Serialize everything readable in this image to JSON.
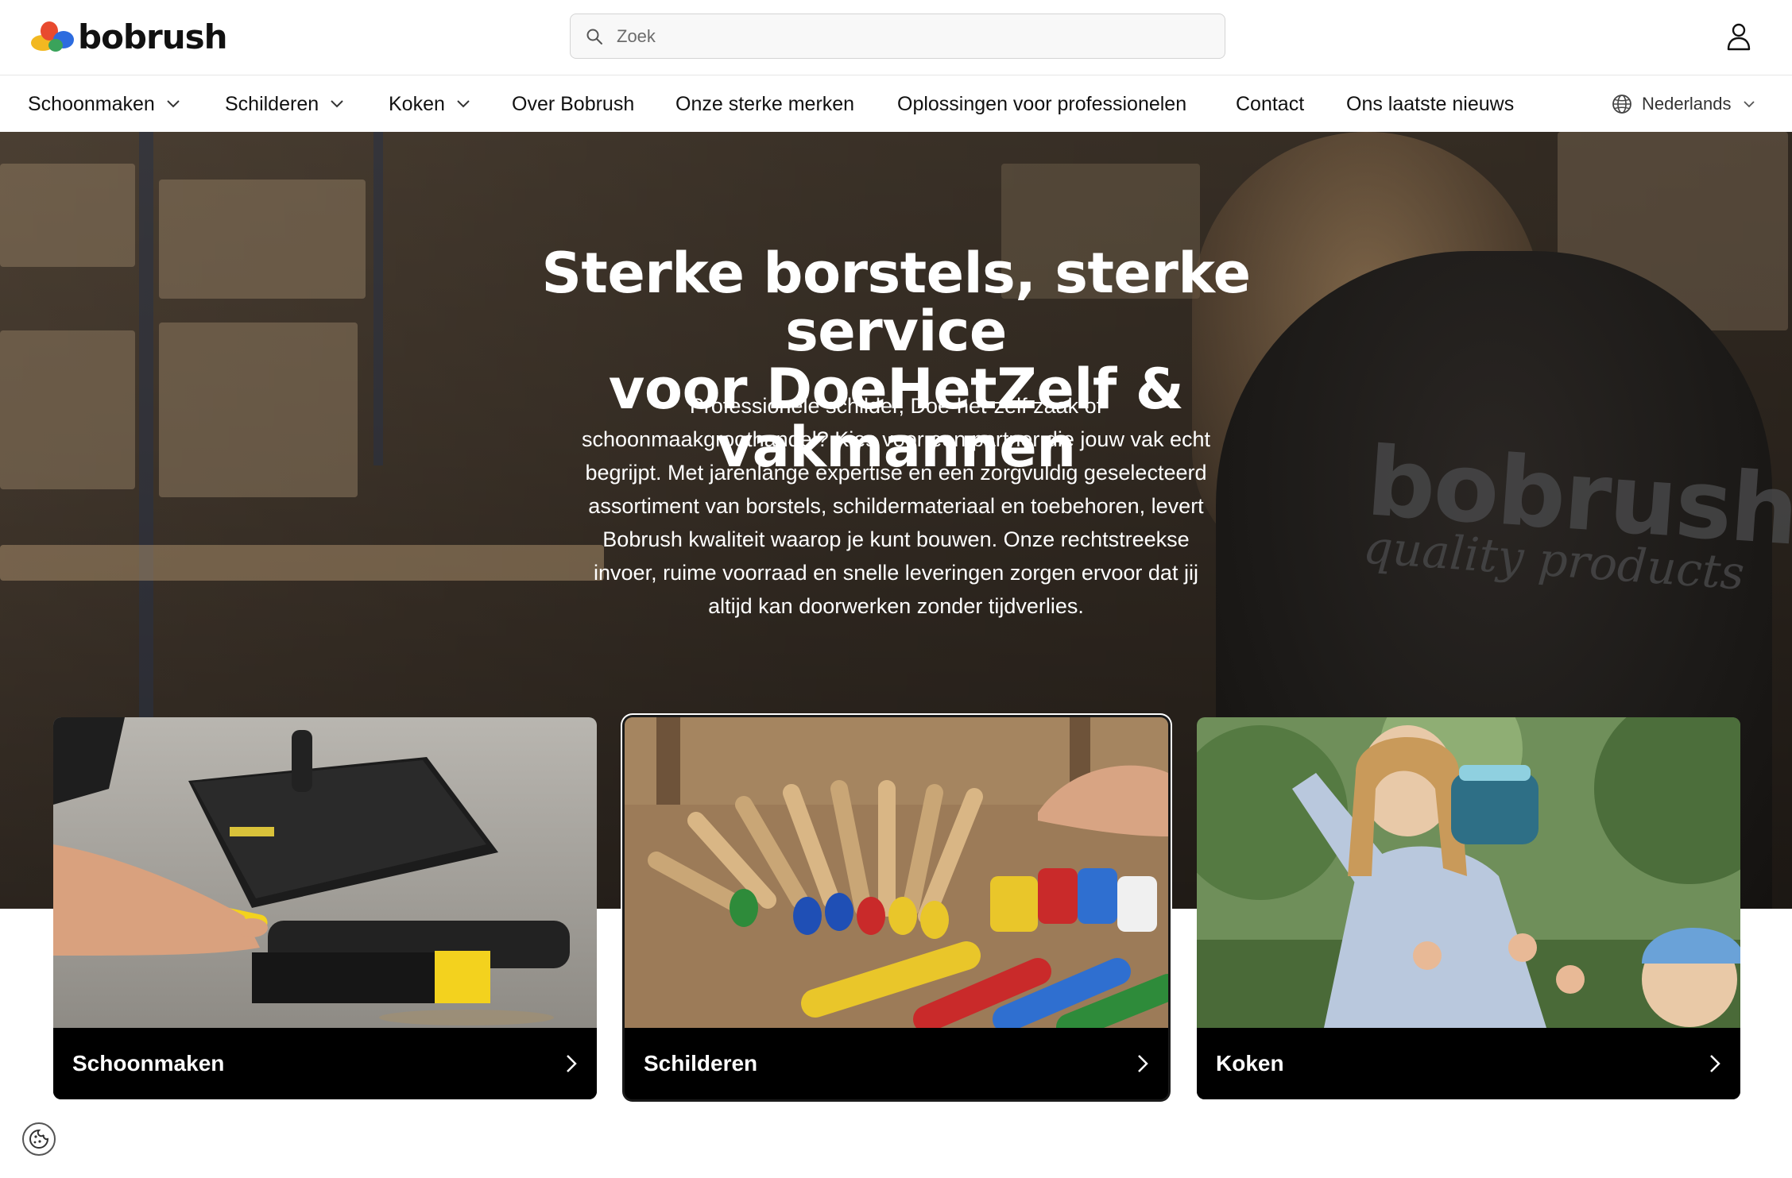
{
  "brand": {
    "name": "bobrush",
    "colors": [
      "#e84a2f",
      "#f2b821",
      "#2d6cdf",
      "#3aa35b"
    ]
  },
  "search": {
    "placeholder": "Zoek",
    "icon": "search-icon"
  },
  "account": {
    "icon": "user-icon"
  },
  "nav": {
    "items": [
      {
        "label": "Schoonmaken",
        "has_dropdown": true
      },
      {
        "label": "Schilderen",
        "has_dropdown": true
      },
      {
        "label": "Koken",
        "has_dropdown": true
      },
      {
        "label": "Over Bobrush",
        "has_dropdown": false
      },
      {
        "label": "Onze sterke merken",
        "has_dropdown": false
      },
      {
        "label": "Oplossingen voor professionelen",
        "has_dropdown": false
      },
      {
        "label": "Contact",
        "has_dropdown": false
      },
      {
        "label": "Ons laatste nieuws",
        "has_dropdown": false
      }
    ],
    "language": {
      "label": "Nederlands",
      "icon": "globe-icon"
    }
  },
  "hero": {
    "title_line1": "Sterke borstels, sterke service",
    "title_line2": "voor DoeHetZelf & vakmannen",
    "body_lines": [
      "Professionele schilder, Doe-het-zelf zaak of",
      "schoonmaakgroothandel? Kies voor een partner die jouw vak echt",
      "begrijpt. Met jarenlange expertise en een zorgvuldig geselecteerd",
      "assortiment van borstels, schildermateriaal en toebehoren, levert",
      "Bobrush kwaliteit waarop je kunt bouwen. Onze rechtstreekse",
      "invoer, ruime voorraad en snelle leveringen zorgen ervoor dat jij",
      "altijd kan doorwerken zonder tijdverlies."
    ],
    "shirt_print": {
      "logo": "bobrush",
      "tagline": "quality products"
    }
  },
  "categories": [
    {
      "label": "Schoonmaken",
      "icon": "chevron-right-icon"
    },
    {
      "label": "Schilderen",
      "icon": "chevron-right-icon"
    },
    {
      "label": "Koken",
      "icon": "chevron-right-icon"
    }
  ],
  "cookie": {
    "icon": "cookie-icon"
  }
}
